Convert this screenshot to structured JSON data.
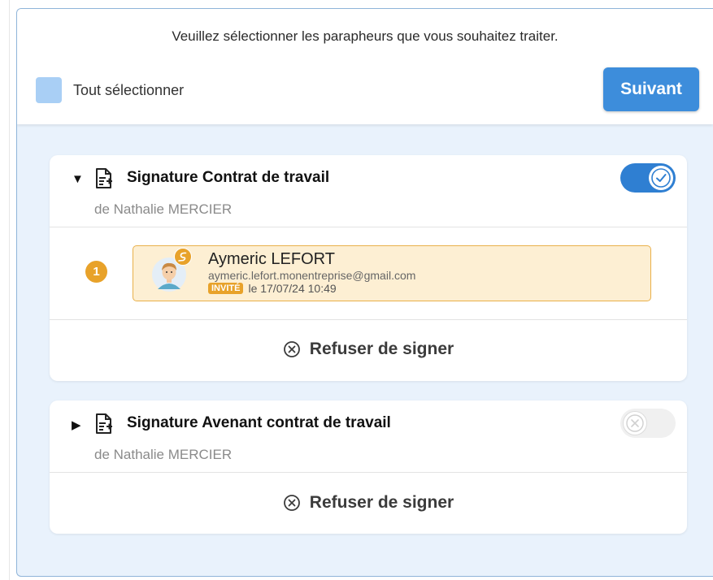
{
  "header": {
    "instruction": "Veuillez sélectionner les parapheurs que vous souhaitez traiter.",
    "select_all_label": "Tout sélectionner",
    "select_all_checked": false,
    "next_button": "Suivant",
    "accent_color": "#3d8ddb"
  },
  "cards": [
    {
      "expanded": true,
      "caret_icon": "caret-down-icon",
      "title": "Signature Contrat de travail",
      "subtitle": "de Nathalie MERCIER",
      "toggle_on": true,
      "signers": [
        {
          "order": "1",
          "name": "Aymeric LEFORT",
          "email": "aymeric.lefort.monentreprise@gmail.com",
          "role": "INVITÉ",
          "date": "le 17/07/24 10:49"
        }
      ],
      "refuse_label": "Refuser de signer"
    },
    {
      "expanded": false,
      "caret_icon": "caret-right-icon",
      "title": "Signature Avenant contrat de travail",
      "subtitle": "de Nathalie MERCIER",
      "toggle_on": false,
      "refuse_label": "Refuser de signer"
    }
  ],
  "icons": {
    "document": "signature-document-icon",
    "refuse": "circle-x-icon",
    "signer_status": "signature-pen-icon"
  },
  "colors": {
    "toggle_on": "#2f7fd2",
    "signer_highlight": "#fdefd3",
    "signer_border": "#e9b04a",
    "badge": "#e8a22a"
  }
}
